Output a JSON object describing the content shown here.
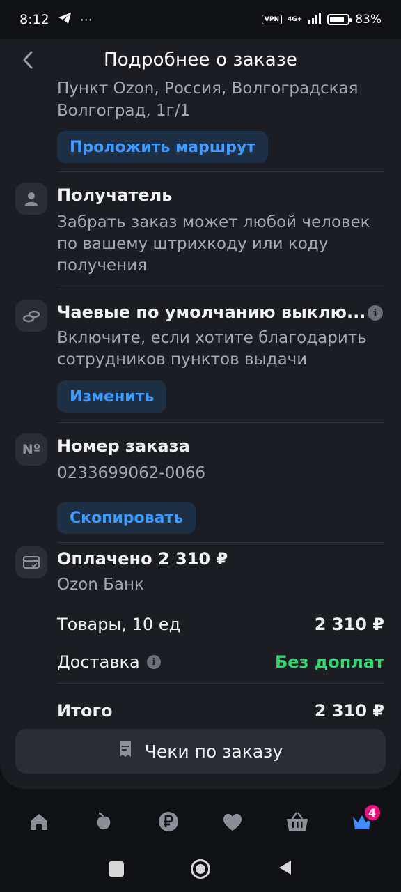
{
  "status_bar": {
    "time": "8:12",
    "vpn": "VPN",
    "network": "4G+",
    "battery_percent": "83%",
    "battery_level": 0.83
  },
  "header": {
    "title": "Подробнее о заказе"
  },
  "address": {
    "line1": "Пункт Ozon, Россия, Волгоградская",
    "line2": "Волгоград, 1г/1",
    "route_button": "Проложить маршрут"
  },
  "recipient": {
    "title": "Получатель",
    "text": "Забрать заказ может любой человек по вашему штрихкоду или коду получения"
  },
  "tips": {
    "title": "Чаевые по умолчанию выклю...",
    "text": "Включите, если хотите благодарить сотрудников пунктов выдачи",
    "button": "Изменить"
  },
  "order_number": {
    "icon_text": "Nº",
    "title": "Номер заказа",
    "value": "0233699062-0066",
    "button": "Скопировать"
  },
  "payment": {
    "title": "Оплачено 2 310 ₽",
    "bank": "Ozon Банк",
    "goods_label": "Товары, 10 ед",
    "goods_value": "2 310 ₽",
    "delivery_label": "Доставка",
    "delivery_value": "Без доплат",
    "total_label": "Итого",
    "total_value": "2 310 ₽"
  },
  "receipts_button": "Чеки по заказу",
  "bottom_nav": {
    "items": [
      "home-icon",
      "fresh-icon",
      "ruble-icon",
      "heart-icon",
      "basket-icon",
      "crown-icon"
    ],
    "badge": "4"
  },
  "colors": {
    "background": "#1b1d22",
    "accent": "#3e9bff",
    "green": "#2ddc6c",
    "badge": "#f1117e"
  }
}
